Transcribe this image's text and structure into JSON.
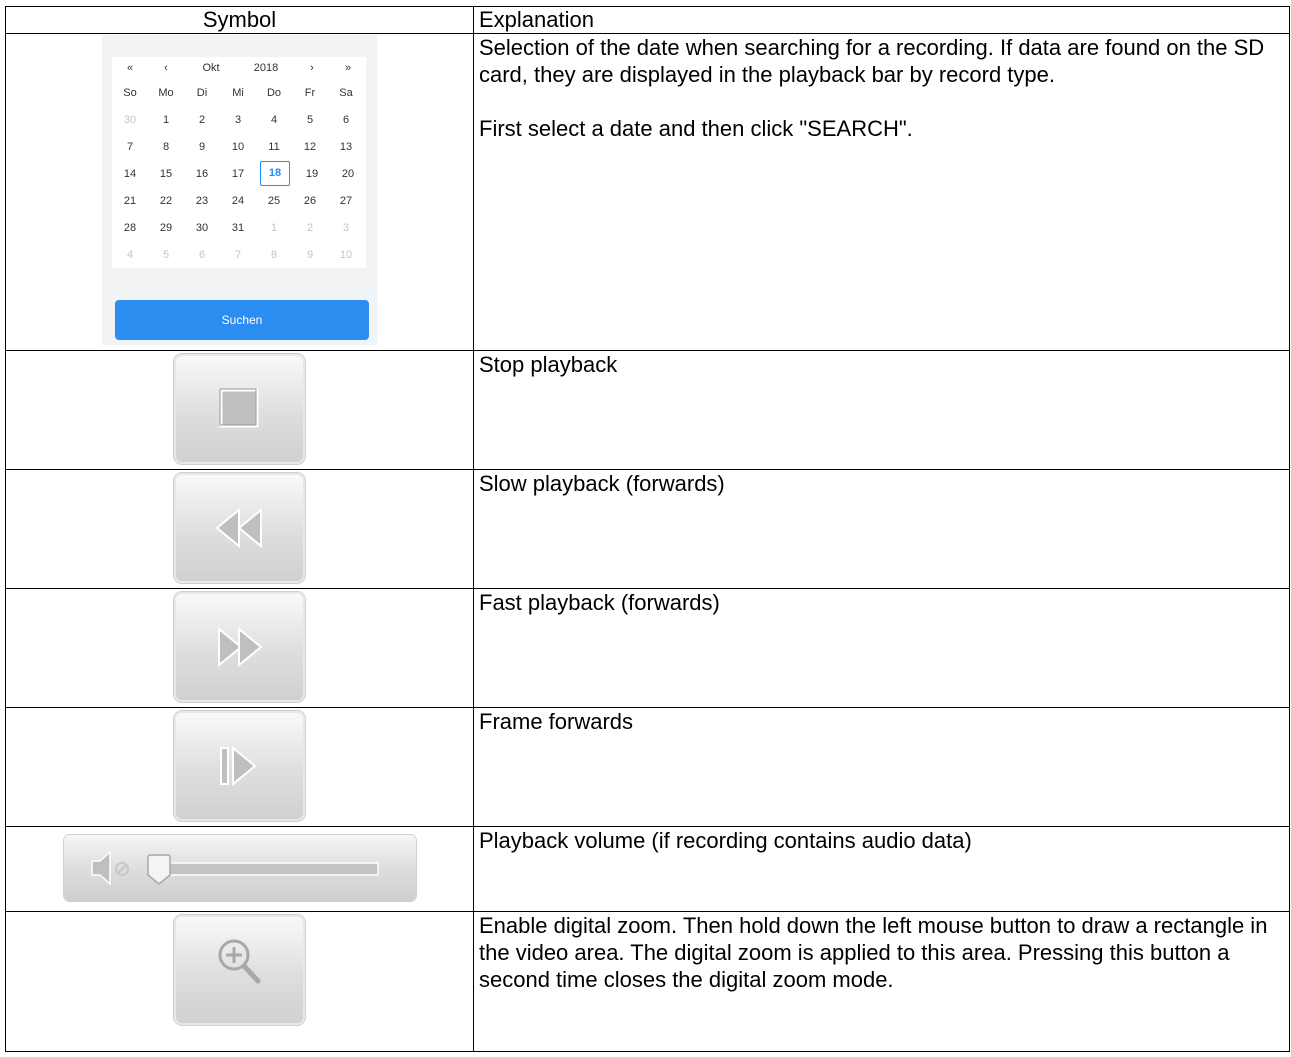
{
  "header": {
    "symbol": "Symbol",
    "explanation": "Explanation"
  },
  "calendar": {
    "nav_first": "«",
    "nav_prev": "‹",
    "month": "Okt",
    "year": "2018",
    "nav_next": "›",
    "nav_last": "»",
    "weekdays": [
      "So",
      "Mo",
      "Di",
      "Mi",
      "Do",
      "Fr",
      "Sa"
    ],
    "weeks": [
      [
        "30",
        "1",
        "2",
        "3",
        "4",
        "5",
        "6"
      ],
      [
        "7",
        "8",
        "9",
        "10",
        "11",
        "12",
        "13"
      ],
      [
        "14",
        "15",
        "16",
        "17",
        "18",
        "19",
        "20"
      ],
      [
        "21",
        "22",
        "23",
        "24",
        "25",
        "26",
        "27"
      ],
      [
        "28",
        "29",
        "30",
        "31",
        "1",
        "2",
        "3"
      ],
      [
        "4",
        "5",
        "6",
        "7",
        "8",
        "9",
        "10"
      ]
    ],
    "selected": "18",
    "search_label": "Suchen",
    "accent_color": "#2b8def"
  },
  "rows": [
    {
      "icon": "calendar-widget",
      "text": [
        "Selection of the date when searching for a recording. If data are found on the SD card, they are displayed in the playback bar by record type.",
        "First select a date and then click \"SEARCH\"."
      ]
    },
    {
      "icon": "stop-icon",
      "text": [
        "Stop playback"
      ]
    },
    {
      "icon": "slow-forward-icon",
      "text": [
        "Slow playback (forwards)"
      ]
    },
    {
      "icon": "fast-forward-icon",
      "text": [
        "Fast playback (forwards)"
      ]
    },
    {
      "icon": "frame-forward-icon",
      "text": [
        "Frame forwards"
      ]
    },
    {
      "icon": "volume-slider",
      "text": [
        "Playback volume (if recording contains audio data)"
      ]
    },
    {
      "icon": "zoom-in-icon",
      "text": [
        "Enable digital zoom. Then hold down the left mouse button to draw a rectangle in the video area. The digital zoom is applied to this area. Pressing this button a second time closes the digital zoom mode."
      ]
    }
  ]
}
